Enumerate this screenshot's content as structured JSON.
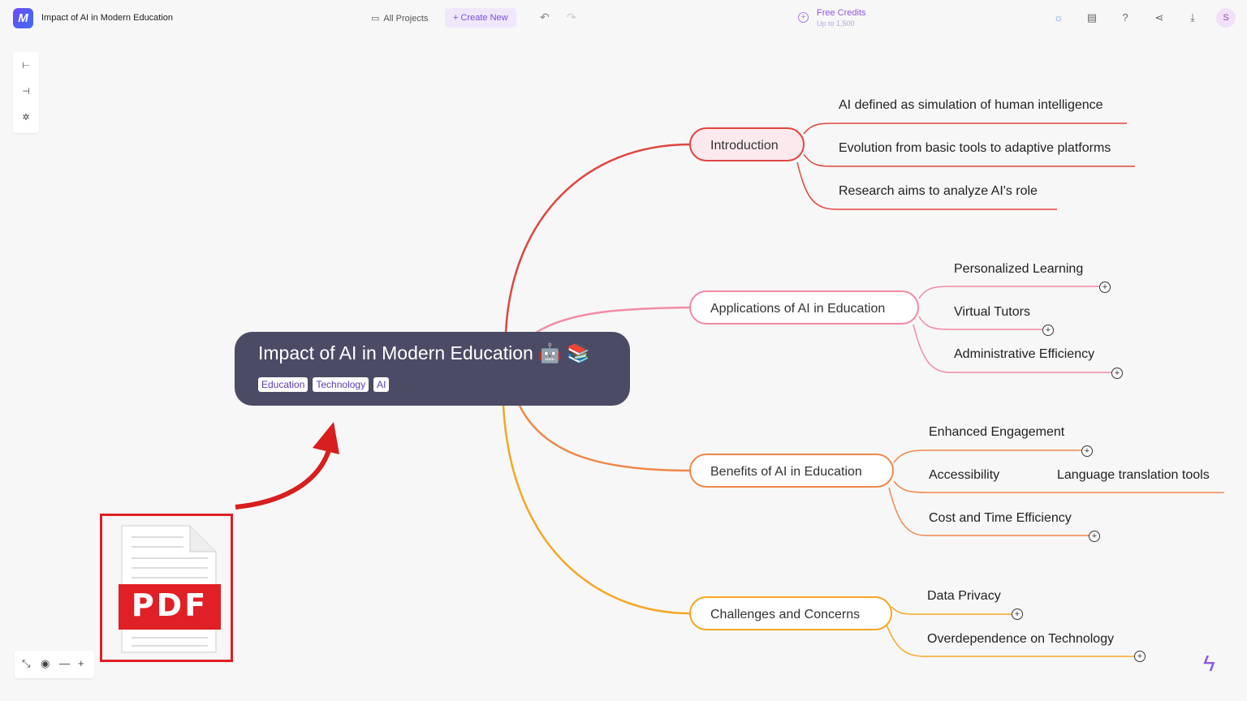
{
  "app": {
    "logo_text": "M",
    "title": "Impact of AI in Modern Education"
  },
  "toolbar": {
    "all_projects": "All Projects",
    "create_new": "Create New",
    "credits_title": "Free Credits",
    "credits_sub": "Up to 1,500",
    "avatar": "S",
    "icons": [
      "theme-icon",
      "outline-icon",
      "help-icon",
      "share-icon",
      "download-icon"
    ]
  },
  "map": {
    "root": {
      "title": "Impact of AI in Modern Education 🤖 📚",
      "tags": [
        "Education",
        "Technology",
        "AI"
      ]
    },
    "colors": {
      "introduction": "#e0463f",
      "applications": "#f28ba5",
      "benefits": "#f0874a",
      "challenges": "#f5a623"
    },
    "branches": [
      {
        "label": "Introduction",
        "children": [
          "AI defined as simulation of human intelligence",
          "Evolution from basic tools to adaptive platforms",
          "Research aims to analyze AI's role"
        ]
      },
      {
        "label": "Applications of AI in Education",
        "children": [
          "Personalized Learning",
          "Virtual Tutors",
          "Administrative Efficiency"
        ]
      },
      {
        "label": "Benefits of AI in Education",
        "children": [
          "Enhanced Engagement",
          "Accessibility",
          "Cost and Time Efficiency"
        ],
        "grandchild": "Language translation tools"
      },
      {
        "label": "Challenges and Concerns",
        "children": [
          "Data Privacy",
          "Overdependence on Technology"
        ]
      }
    ]
  },
  "overlay": {
    "pdf_label": "PDF"
  }
}
